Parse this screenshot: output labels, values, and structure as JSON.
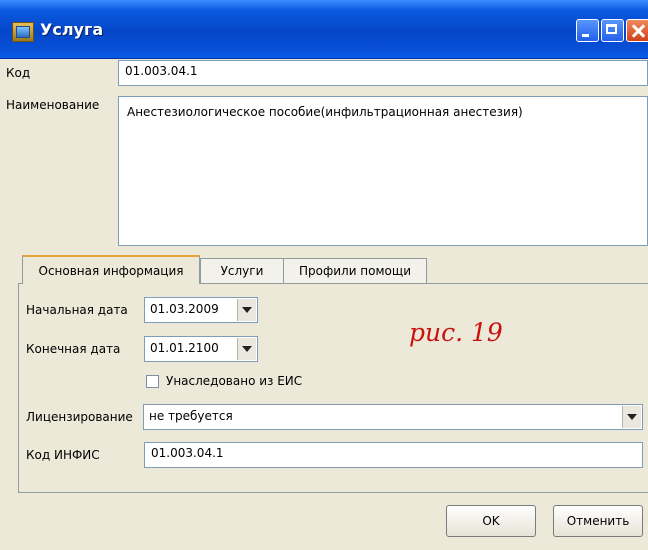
{
  "window": {
    "title": "Услуга"
  },
  "form": {
    "code_label": "Код",
    "code_value": "01.003.04.1",
    "name_label": "Наименование",
    "name_value": "Анестезиологическое пособие(инфильтрационная анестезия)"
  },
  "tabs": [
    {
      "label": "Основная информация",
      "active": true
    },
    {
      "label": "Услуги",
      "active": false
    },
    {
      "label": "Профили помощи",
      "active": false
    }
  ],
  "main_info": {
    "start_date_label": "Начальная дата",
    "start_date_value": "01.03.2009",
    "end_date_label": "Конечная дата",
    "end_date_value": "01.01.2100",
    "inherited_label": "Унаследовано из ЕИС",
    "inherited_checked": false,
    "licensing_label": "Лицензирование",
    "licensing_value": "не требуется",
    "infis_label": "Код ИНФИС",
    "infis_value": "01.003.04.1"
  },
  "annotation": "рис. 19",
  "buttons": {
    "ok": "OK",
    "cancel": "Отменить"
  },
  "colors": {
    "titlebar": "#0546c8",
    "annotation": "#cc1010",
    "window_bg": "#ece9d8"
  }
}
